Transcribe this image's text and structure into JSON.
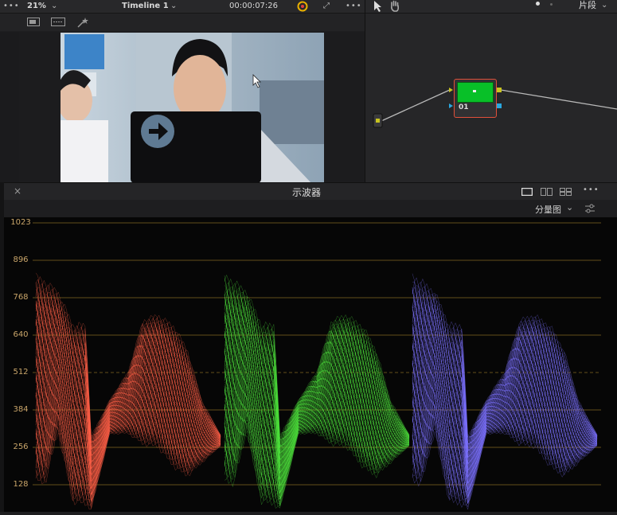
{
  "viewer": {
    "zoom": "21%",
    "timeline_name": "Timeline 1",
    "timecode": "00:00:07:26"
  },
  "node_panel": {
    "mode_label": "片段",
    "node_label": "01"
  },
  "scope": {
    "title": "示波器",
    "view_mode": "分量图",
    "tick_labels": [
      "1023",
      "896",
      "768",
      "640",
      "512",
      "384",
      "256",
      "128"
    ]
  },
  "colors": {
    "red_channel": "#ff6048",
    "green_channel": "#4ee23c",
    "blue_channel": "#7c72ff",
    "graticule": "#b8902e",
    "node_green": "#08c028",
    "node_border": "#e0503a"
  },
  "icons": [
    "more-icon",
    "chevron-down-icon",
    "color-wheel-icon",
    "fullscreen-icon",
    "pointer-icon",
    "hand-icon",
    "close-icon",
    "single-view-icon",
    "dual-view-icon",
    "quad-view-icon",
    "settings-icon"
  ]
}
